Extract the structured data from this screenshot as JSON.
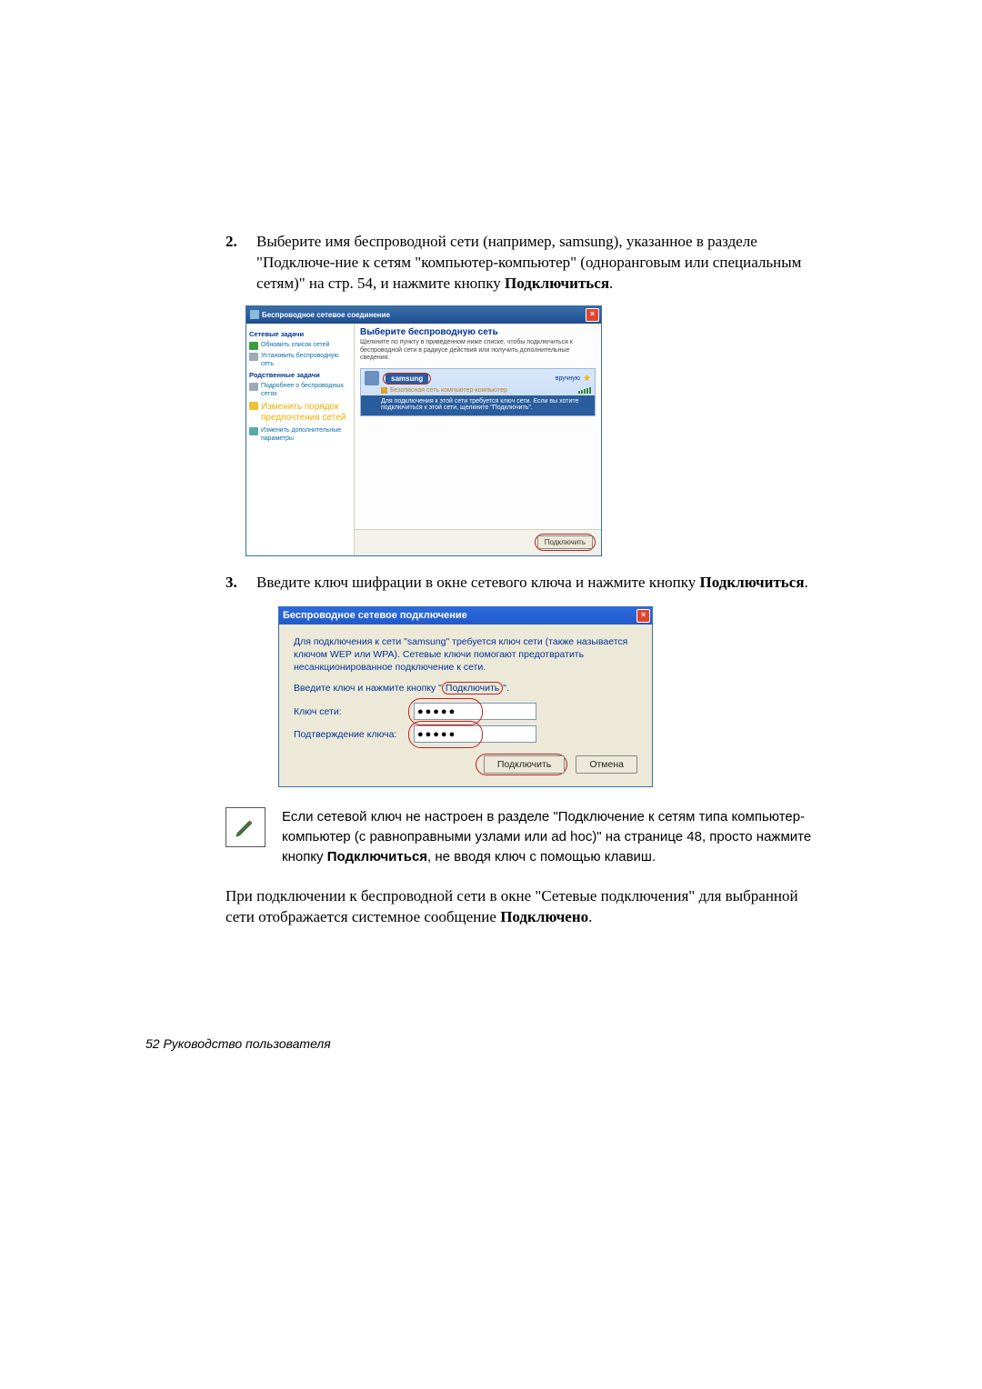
{
  "step2": {
    "num": "2.",
    "text_a": "Выберите имя беспроводной сети (например, samsung), указанное в разделе \"Подключе-ние к сетям \"компьютер-компьютер\" (одноранговым или специальным сетям)\" на стр. 54, и нажмите кнопку ",
    "text_bold": "Подключиться",
    "text_end": "."
  },
  "win1": {
    "title": "Беспроводное сетевое соединение",
    "side_head1": "Сетевые задачи",
    "side_refresh": "Обновить список сетей",
    "side_setup": "Установить беспроводную сеть",
    "side_head2": "Родственные задачи",
    "side_learn": "Подробнее о беспроводных сетях",
    "side_order": "Изменить порядок предпочтения сетей",
    "side_adv": "Изменить дополнительные параметры",
    "rp_head": "Выберите беспроводную сеть",
    "rp_sub": "Щелкните по пункту в приведенном ниже списке, чтобы подключиться к беспроводной сети в радиусе действия или получить дополнительные сведения.",
    "ssid": "samsung",
    "manual": "вручную",
    "sec_label": "Безопасная сеть компьютер-компьютер",
    "ni_desc": "Для подключения к этой сети требуется ключ сети. Если вы хотите подключиться к этой сети, щелкните \"Подключить\".",
    "connect": "Подключить"
  },
  "step3": {
    "num": "3.",
    "text_a": "Введите ключ шифрации в окне сетевого ключа и нажмите кнопку ",
    "text_bold": "Подключиться",
    "text_end": "."
  },
  "dlg2": {
    "title": "Беспроводное сетевое подключение",
    "p1": "Для подключения к сети \"samsung\" требуется ключ сети (также называется ключом WEP или WPA). Сетевые ключи помогают предотвратить несанкционированное подключение к сети.",
    "p2a": "Введите ключ и нажмите кнопку \"",
    "p2b": "Подключить",
    "p2c": "\".",
    "lbl_key": "Ключ сети:",
    "lbl_conf": "Подтверждение ключа:",
    "dots": "●●●●●",
    "btn_connect": "Подключить",
    "btn_cancel": "Отмена"
  },
  "note": {
    "t1": "Если сетевой ключ не настроен в разделе ",
    "t2": "\"Подключение к сетям типа компьютер-компьютер (с равноправными узлами или ad hoc)\" на странице 48",
    "t3": ", просто нажмите кнопку ",
    "t4": "Подключиться",
    "t5": ", не вводя ключ с помощью клавиш."
  },
  "para": {
    "a": "При подключении к беспроводной сети в окне \"Сетевые подключения\" для выбранной сети отображается системное сообщение ",
    "b": "Подключено",
    "c": "."
  },
  "footer": "52  Руководство пользователя"
}
